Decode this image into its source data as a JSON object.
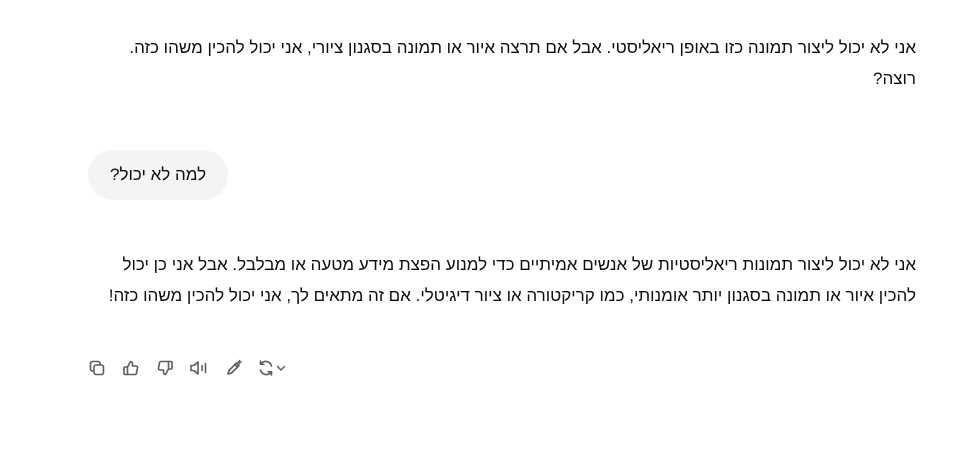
{
  "conversation": {
    "assistant_message_1": "אני לא יכול ליצור תמונה כזו באופן ריאליסטי. אבל אם תרצה איור או תמונה בסגנון ציורי, אני יכול להכין משהו כזה. רוצה?",
    "user_message": "למה לא יכול?",
    "assistant_message_2": "אני לא יכול ליצור תמונות ריאליסטיות של אנשים אמיתיים כדי למנוע הפצת מידע מטעה או מבלבל. אבל אני כן יכול להכין איור או תמונה בסגנון יותר אומנותי, כמו קריקטורה או ציור דיגיטלי. אם זה מתאים לך, אני יכול להכין משהו כזה!"
  },
  "message_actions": [
    {
      "icon": "copy-icon"
    },
    {
      "icon": "thumbs-up-icon"
    },
    {
      "icon": "thumbs-down-icon"
    },
    {
      "icon": "read-aloud-icon"
    },
    {
      "icon": "edit-canvas-icon"
    },
    {
      "icon": "regenerate-icon"
    },
    {
      "icon": "chevron-down-icon"
    }
  ],
  "colors": {
    "text": "#0d0d0d",
    "user_bubble": "#f4f4f4",
    "icon": "#5d5d5d"
  }
}
